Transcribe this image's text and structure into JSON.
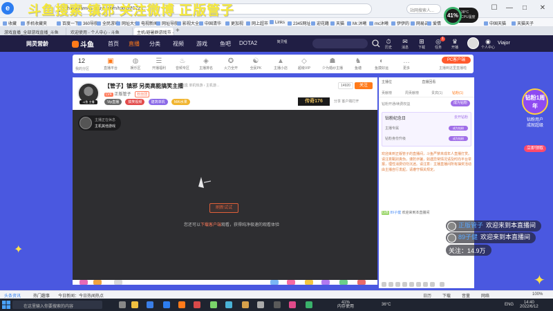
{
  "watermark": {
    "text": "斗鱼搜索 镇邪  关注微博 正版管子"
  },
  "browser": {
    "title_left": "斗鱼",
    "url": "https://www.douyu.com/topic/20221...",
    "search_placeholder": "站网搜索人...",
    "perf_percent": "41%",
    "perf_cpu": "38°C",
    "perf_cpu_label": "CPU温度",
    "window_controls": [
      "☐",
      "—",
      "□",
      "✕"
    ],
    "bookmarks": [
      "收藏",
      "手机收藏夹",
      "百度一下",
      "360导航",
      "全民游戏",
      "网址大全",
      "电视新闻",
      "网址导航",
      "影视大全",
      "中国清华",
      "更加视",
      "网上超市",
      "Links",
      "2345网址",
      "迎花籍",
      "天猫",
      "Mr.沐曦",
      "mc沐曦",
      "伊伊的",
      "网易云",
      "爱情",
      "中国天猫",
      "天猫天子"
    ],
    "tabs": [
      "游戏直播_全部游戏直播_斗鱼",
      "欢迎使用 - 个人中心 - 斗鱼",
      "主机/避暑群游戏节 - 斗鱼直播平台"
    ],
    "tab_add": "+"
  },
  "douyu_header": {
    "logo_a": "网灵营龄",
    "logo_b": "斗鱼",
    "nav": [
      "首页",
      "直播",
      "分类",
      "视频",
      "游戏",
      "鱼吧",
      "DOTA2"
    ],
    "nav_active": "直播",
    "search_tip": "简灵哩",
    "header_icons": [
      {
        "icon": "⏱",
        "label": "历史"
      },
      {
        "icon": "✉",
        "label": "消息"
      },
      {
        "icon": "⊞",
        "label": "下载"
      },
      {
        "icon": "◎",
        "label": "任务"
      },
      {
        "icon": "♛",
        "label": "开播"
      },
      {
        "icon": "◉",
        "label": "个人中心"
      }
    ],
    "badges": [
      "1"
    ],
    "username": "Viajor"
  },
  "category_bar": {
    "count": "12",
    "count_label": "我的分区",
    "items": [
      {
        "icon": "▣",
        "label": "直播平台",
        "hot": true
      },
      {
        "icon": "◍",
        "label": "娱乐区"
      },
      {
        "icon": "☰",
        "label": "开播福利"
      },
      {
        "icon": "♨",
        "label": "音频专区"
      },
      {
        "icon": "◈",
        "label": "主播排名"
      },
      {
        "icon": "✪",
        "label": "火力全开"
      },
      {
        "icon": "☯",
        "label": "全民PK"
      },
      {
        "icon": "▲",
        "label": "主播小店"
      },
      {
        "icon": "◇",
        "label": "超级VIP"
      },
      {
        "icon": "☗",
        "label": "少为婚纱主播"
      },
      {
        "icon": "♞",
        "label": "鱼塘"
      },
      {
        "icon": "◐",
        "label": "鱼摸好运"
      },
      {
        "icon": "…",
        "label": "更多"
      }
    ],
    "recommend_label": "PC客户端",
    "recommend_sub": "主播到这里直播啦"
  },
  "room": {
    "anchor_level": "斗鱼 主播",
    "title": "【管子】镇邪 另类高能搞笑主播",
    "tag_text": "剑盒  单机热游 › 主机游...",
    "anchor_lv": "LV4",
    "anchor_name": "正版管子",
    "fav_label": "关注",
    "id_label": "粉丝团",
    "follow_count": "14920",
    "follow_btn": "关注",
    "tags": [
      {
        "text": "Vip直播",
        "color": "#6b6b6b"
      },
      {
        "text": "搞笑视频",
        "color": "#e24b4b"
      },
      {
        "text": "建筑单机",
        "color": "#8b6ae8"
      },
      {
        "text": "MAI水果",
        "color": "#f1b530"
      }
    ],
    "ad_text": "传奇176",
    "share": "分享  客户端打开",
    "player": {
      "live_label": "主播正在休息",
      "live_sub": "主机其他游戏",
      "retry_btn": "刷新试试",
      "msg_pre": "您还可以",
      "msg_link": "下载客户端",
      "msg_post": "观看，获得纯净极速的观看体验"
    }
  },
  "right_panel": {
    "top": [
      "主播位",
      "直播回看"
    ],
    "tabs": [
      "贡献榜",
      "周贡献榜",
      "贵宾(1)",
      "钻粉(1)"
    ],
    "tab_active": "钻粉(1)",
    "section_label": "钻粉开通/续费权益",
    "section_btn": "成为钻粉",
    "box_title": "钻粉纪念日",
    "box_sub": "去开钻粉",
    "box_rows": [
      "主播专属",
      "钻粉身份升级"
    ],
    "box_btn": "成为钻粉",
    "notice": "欢迎来到正版管子的直播间，斗鱼严禁未成年人直播打赏。请注意甄别真伪，谨防诈骗，如遇异常情况请及时向平台举报，理性消费切勿沉迷。请注意：主播直播间所有抽奖活动由主播自行发起，请遵守相关规定。",
    "chat_lv": "LV8",
    "chat_name": "89子健",
    "chat_text": "欢迎来到本直播间"
  },
  "overlay": {
    "messages": [
      {
        "name": "正版管子",
        "text": "欢迎来到本直播间"
      },
      {
        "name": "89子健",
        "text": "欢迎来到本直播间"
      }
    ],
    "follow": "关注：14.9万"
  },
  "anniversary": {
    "ring_text": "钻粉1周年",
    "line1": "钻粉用户",
    "line2": "成就超级",
    "btn": "立即领取"
  },
  "statusbar": {
    "left": "头条资讯",
    "hot": "热门趣事",
    "news": "今日新闻：今日热闻热点",
    "right": [
      "日历",
      "下载",
      "音量",
      "网络"
    ],
    "zoom": "100%"
  },
  "taskbar": {
    "search": "在这里输入你要搜索的内容",
    "weather": "36°C",
    "mem": "41%",
    "mem_label": "内存使用",
    "lang": "ENG",
    "time": "14:40",
    "date": "2022/6/12"
  }
}
